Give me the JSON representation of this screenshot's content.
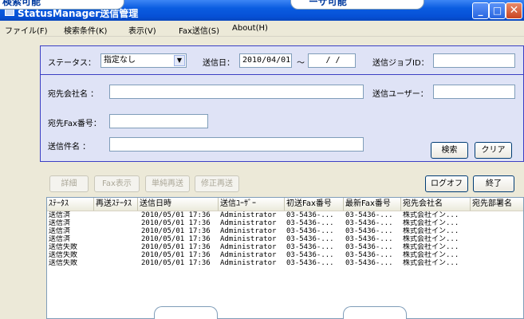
{
  "top_callouts": [
    "検索可能",
    "ーザ可能"
  ],
  "window": {
    "title": "StatusManager送信管理",
    "min_glyph": "_",
    "max_glyph": "□",
    "close_glyph": "✕"
  },
  "menu": [
    "ファイル(F)",
    "検索条件(K)",
    "表示(V)",
    "Fax送信(S)",
    "About(H)"
  ],
  "search": {
    "status_label": "ステータス：",
    "status_value": "指定なし",
    "send_date_label": "送信日：",
    "send_date_from": "2010/04/01",
    "tilde": "〜",
    "send_date_to": "/ /",
    "job_id_label": "送信ジョブID：",
    "job_id_value": "",
    "company_label": "宛先会社名 ：",
    "company_value": "",
    "sender_user_label": "送信ユーザー：",
    "sender_user_value": "",
    "fax_label": "宛先Fax番号：",
    "fax_value": "",
    "subject_label": "送信件名 ：",
    "subject_value": "",
    "search_button": "検索",
    "clear_button": "クリア"
  },
  "toolbar": {
    "detail": "詳細",
    "fax_view": "Fax表示",
    "single_resend": "単純再送",
    "modify_resend": "修正再送",
    "logoff": "ログオフ",
    "exit": "終了"
  },
  "list": {
    "columns": [
      "ｽﾃｰﾀｽ",
      "再送ｽﾃｰﾀｽ",
      "送信日時",
      "送信ﾕｰｻﾞｰ",
      "初送Fax番号",
      "最新Fax番号",
      "宛先会社名",
      "宛先部署名"
    ],
    "rows": [
      [
        "送信済",
        "",
        "2010/05/01 17:36",
        "Administrator",
        "03-5436-...",
        "03-5436-...",
        "株式会社イン...",
        ""
      ],
      [
        "送信済",
        "",
        "2010/05/01 17:36",
        "Administrator",
        "03-5436-...",
        "03-5436-...",
        "株式会社イン...",
        ""
      ],
      [
        "送信済",
        "",
        "2010/05/01 17:36",
        "Administrator",
        "03-5436-...",
        "03-5436-...",
        "株式会社イン...",
        ""
      ],
      [
        "送信済",
        "",
        "2010/05/01 17:36",
        "Administrator",
        "03-5436-...",
        "03-5436-...",
        "株式会社イン...",
        ""
      ],
      [
        "送信失敗",
        "",
        "2010/05/01 17:36",
        "Administrator",
        "03-5436-...",
        "03-5436-...",
        "株式会社イン...",
        ""
      ],
      [
        "送信失敗",
        "",
        "2010/05/01 17:36",
        "Administrator",
        "03-5436-...",
        "03-5436-...",
        "株式会社イン...",
        ""
      ],
      [
        "送信失敗",
        "",
        "2010/05/01 17:36",
        "Administrator",
        "03-5436-...",
        "03-5436-...",
        "株式会社イン...",
        ""
      ]
    ]
  },
  "colors": {
    "titlebar": "#0a5ce0",
    "panel_bg": "#dfe3f6",
    "panel_border": "#3b3fc4",
    "window_bg": "#ece9d8"
  }
}
